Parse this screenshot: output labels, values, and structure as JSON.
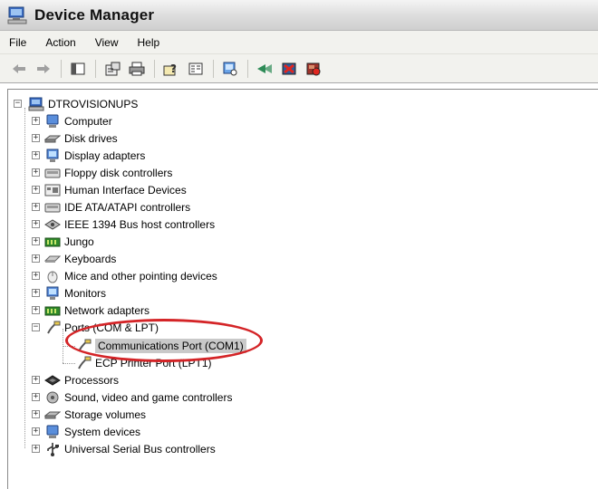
{
  "window": {
    "title": "Device Manager"
  },
  "menu": [
    "File",
    "Action",
    "View",
    "Help"
  ],
  "toolbar": {
    "icons": [
      "back-arrow-icon",
      "forward-arrow-icon",
      "show-hide-tree-icon",
      "properties-icon",
      "print-icon",
      "help-icon",
      "view-icon",
      "scan-hardware-icon",
      "update-driver-icon",
      "uninstall-icon",
      "disable-icon"
    ]
  },
  "tree": {
    "root": "DTROVISIONUPS",
    "categories": [
      "Computer",
      "Disk drives",
      "Display adapters",
      "Floppy disk controllers",
      "Human Interface Devices",
      "IDE ATA/ATAPI controllers",
      "IEEE 1394 Bus host controllers",
      "Jungo",
      "Keyboards",
      "Mice and other pointing devices",
      "Monitors",
      "Network adapters",
      "Ports (COM & LPT)",
      "Processors",
      "Sound, video and game controllers",
      "Storage volumes",
      "System devices",
      "Universal Serial Bus controllers"
    ],
    "ports_children": [
      "Communications Port (COM1)",
      "ECP Printer Port (LPT1)"
    ]
  },
  "colors": {
    "annotation": "#d42427",
    "selection": "#c9c9c9"
  }
}
